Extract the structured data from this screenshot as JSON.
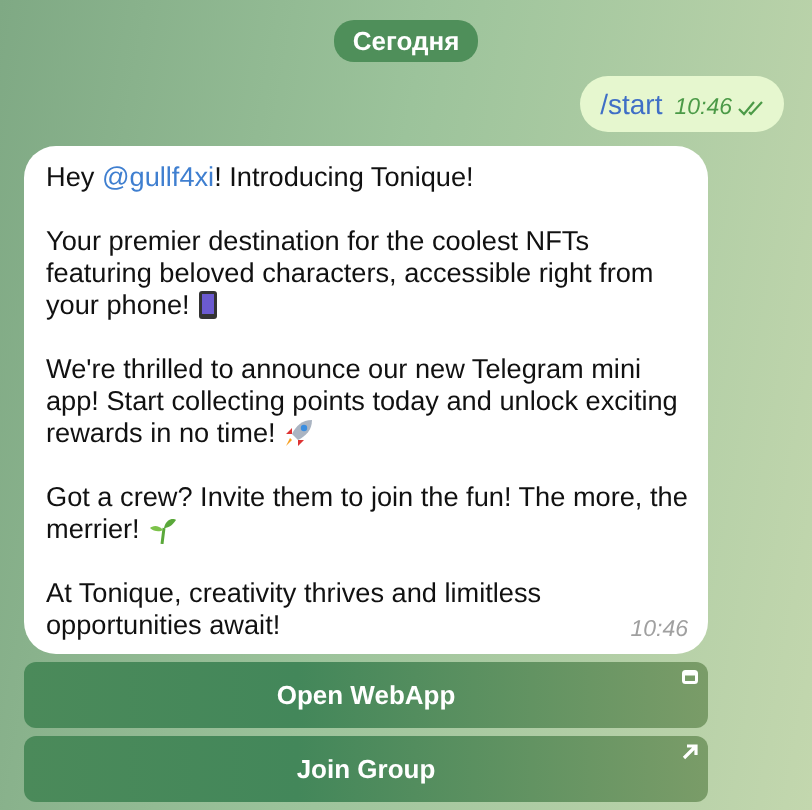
{
  "date_badge": "Сегодня",
  "outgoing": {
    "text": "/start",
    "time": "10:46",
    "read": true
  },
  "incoming": {
    "paragraphs": [
      {
        "before": "Hey ",
        "mention": "@gullf4xi",
        "after": "! Introducing Tonique!"
      },
      {
        "text": "Your premier destination for the coolest NFTs featuring beloved characters, accessible right from your phone!",
        "kind": "phone"
      },
      {
        "text": "We're thrilled to announce our new Telegram mini app! Start collecting points today and unlock exciting rewards in no time!",
        "kind": "rocket"
      },
      {
        "text": "Got a crew? Invite them to join the fun! The more, the merrier!",
        "kind": "sprout"
      },
      {
        "text": "At Tonique, creativity thrives and limitless opportunities await!"
      }
    ],
    "time": "10:46"
  },
  "buttons": [
    {
      "label": "Open WebApp",
      "kind": "webapp"
    },
    {
      "label": "Join Group",
      "kind": "link"
    }
  ]
}
